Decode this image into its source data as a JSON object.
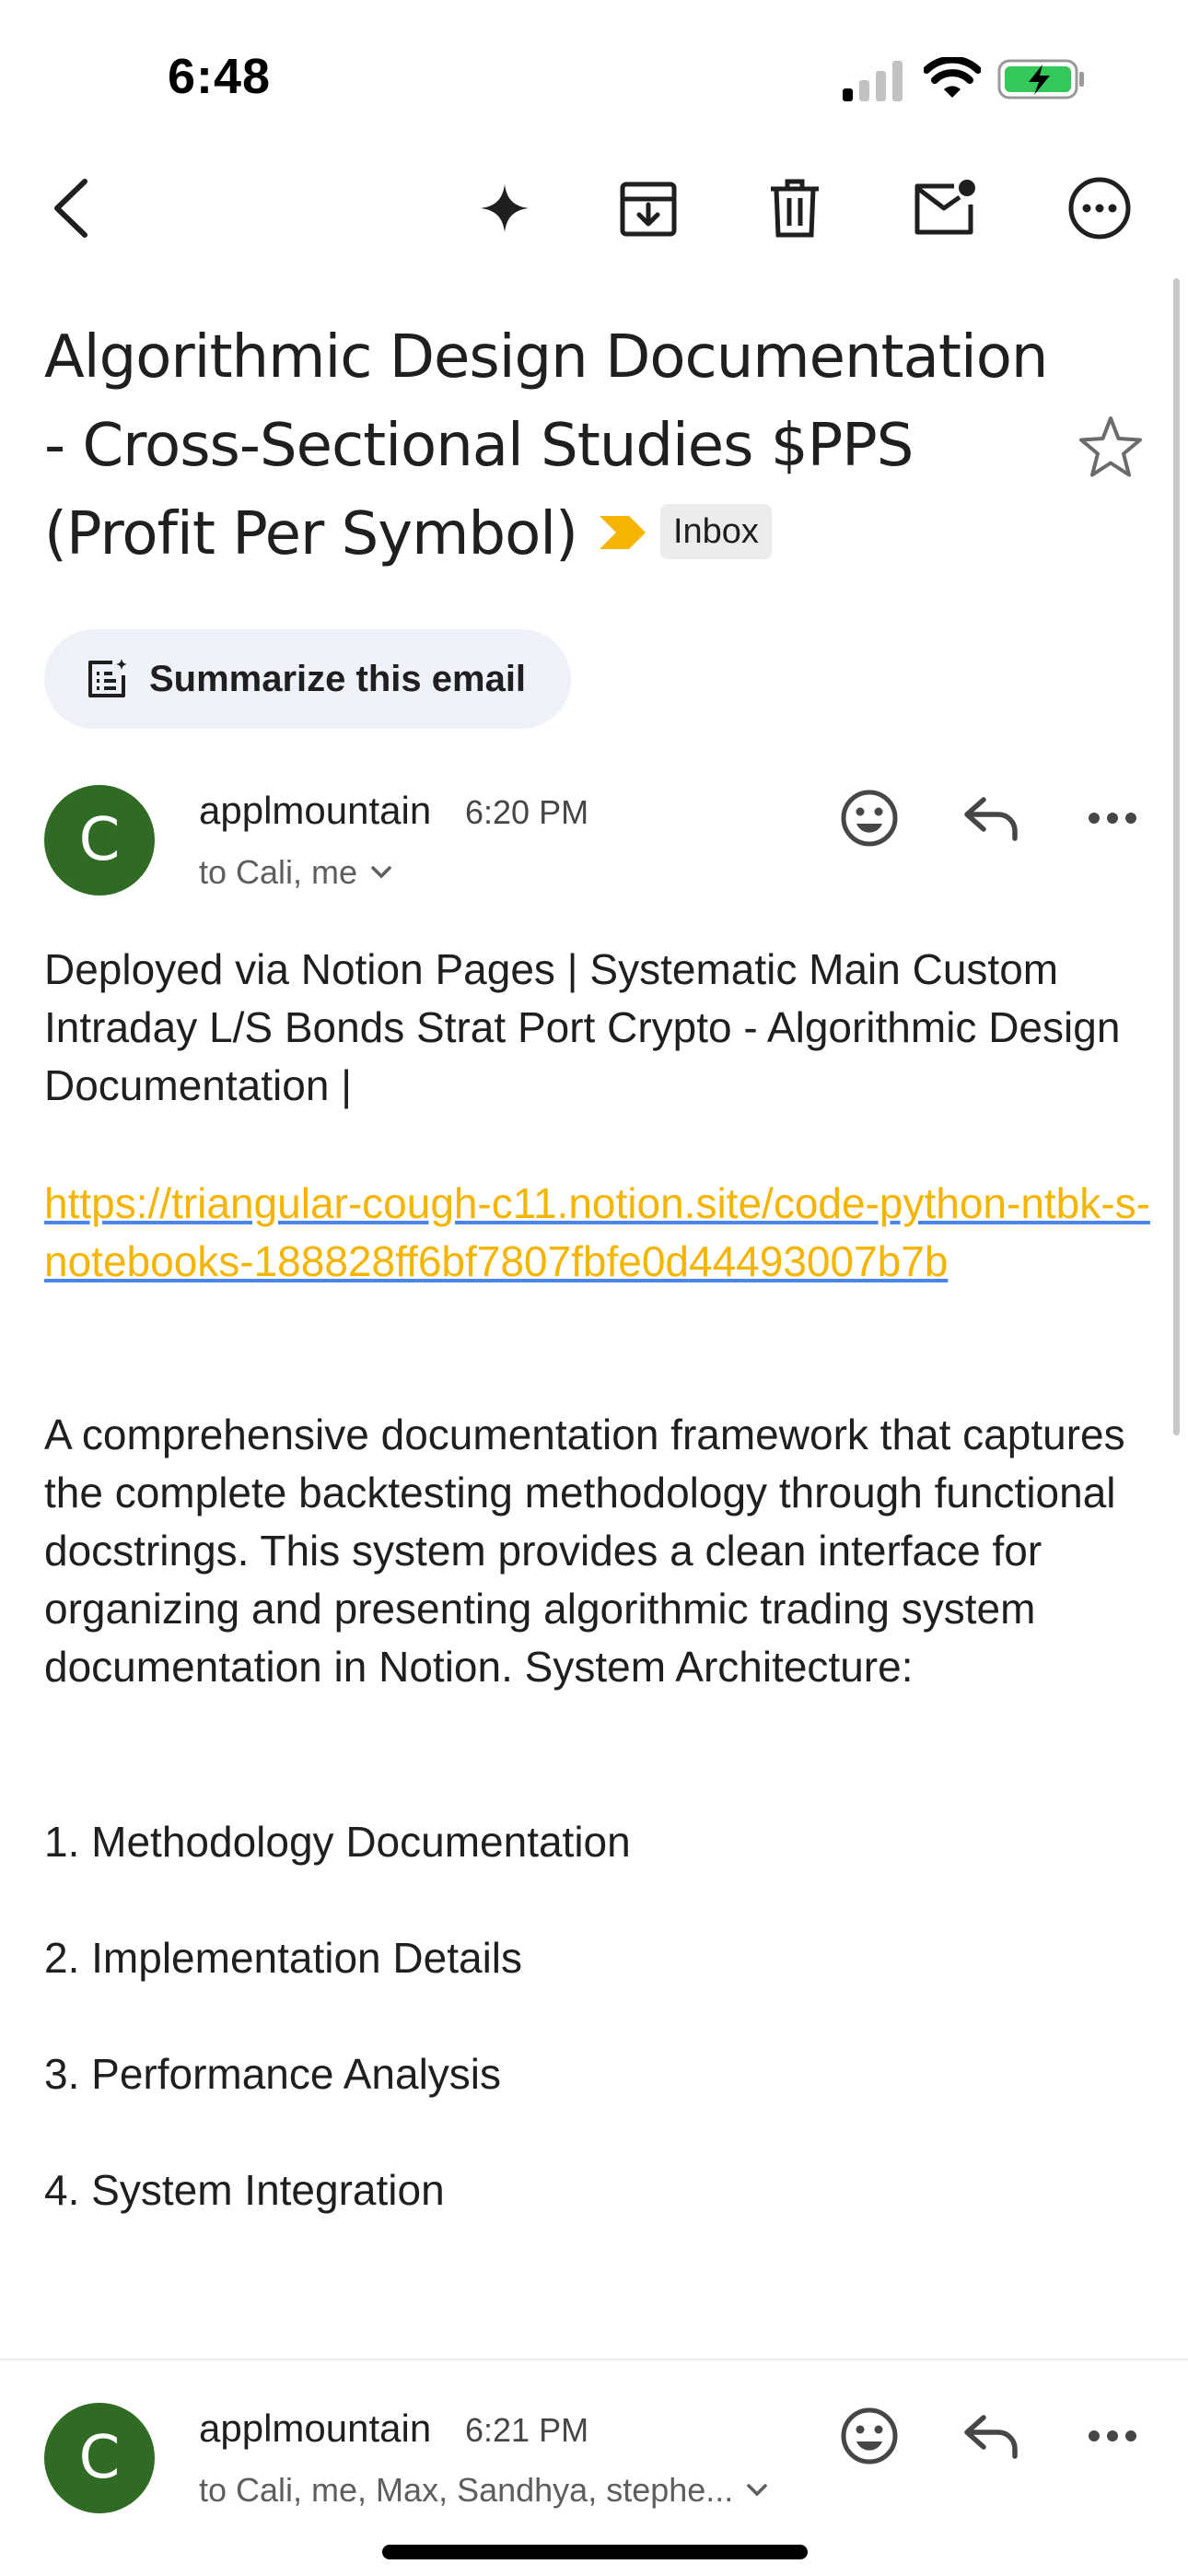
{
  "status_bar": {
    "time": "6:48"
  },
  "toolbar": {
    "back": "back-icon",
    "sparkle": "sparkle-icon",
    "archive": "archive-icon",
    "delete": "trash-icon",
    "mark_unread": "mark-unread-icon",
    "more": "more-icon"
  },
  "subject": {
    "title": "Algorithmic Design Documentation - Cross-Sectional Studies $PPS (Profit Per Symbol)",
    "label": "Inbox",
    "importance_color": "#f4b400"
  },
  "summarize": {
    "label": "Summarize this email"
  },
  "message1": {
    "avatar_initial": "C",
    "sender": "applmountain",
    "time": "6:20 PM",
    "recipients": "to Cali, me",
    "body_intro": "Deployed via Notion Pages | Systematic Main Custom Intraday L/S Bonds Strat Port Crypto - Algorithmic Design Documentation |",
    "link": "https://triangular-cough-c11.notion.site/code-python-ntbk-s-notebooks-188828ff6bf7807fbfe0d44493007b7b",
    "body_paragraph": "A comprehensive documentation framework that captures the complete backtesting methodology through functional docstrings. This system provides a clean interface for organizing and presenting algorithmic trading system documentation in Notion. System Architecture:",
    "list": [
      "1. Methodology Documentation",
      "2. Implementation Details",
      "3. Performance Analysis",
      "4. System Integration"
    ]
  },
  "message2": {
    "avatar_initial": "C",
    "sender": "applmountain",
    "time": "6:21 PM",
    "recipients": "to Cali, me, Max, Sandhya, stephe..."
  },
  "colors": {
    "avatar": "#2f6b24",
    "chip": "#eef2f8",
    "link": "#f4b400"
  }
}
